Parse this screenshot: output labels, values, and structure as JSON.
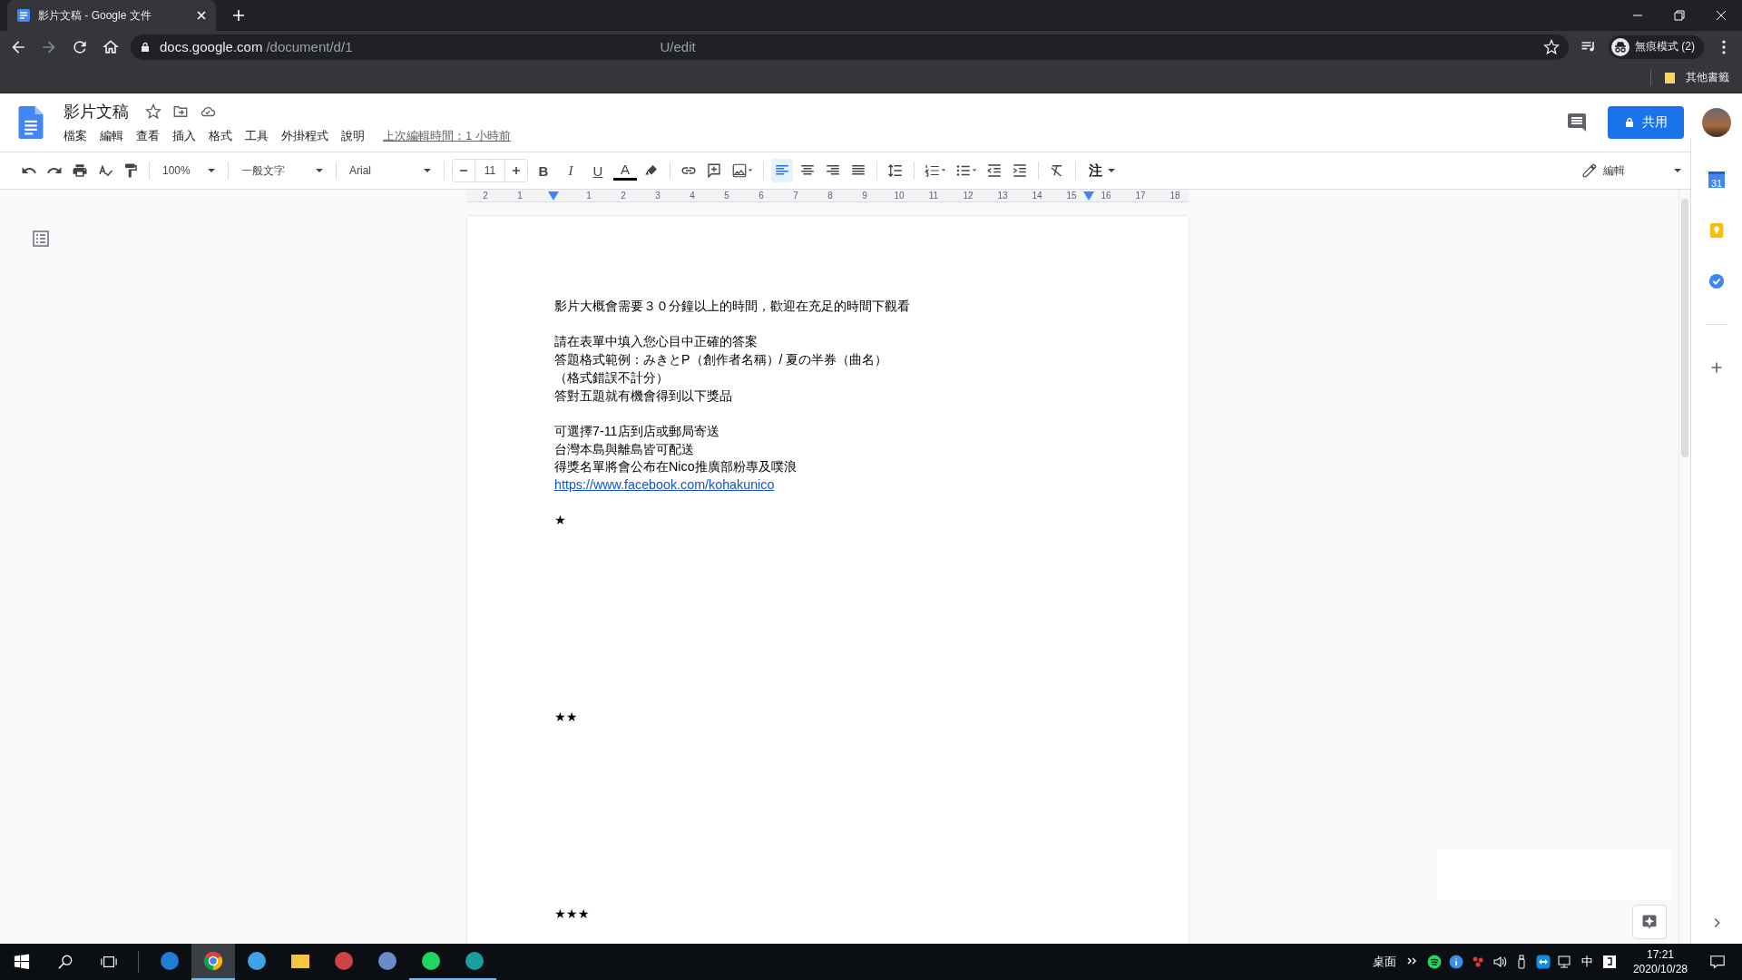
{
  "browser": {
    "tab_title": "影片文稿 - Google 文件",
    "url_host": "docs.google.com",
    "url_path": "/document/d/1",
    "url_tail": "U/edit",
    "profile": "無痕模式 (2)",
    "bookmark": "其他書籤"
  },
  "docs": {
    "title": "影片文稿",
    "menus": [
      "檔案",
      "編輯",
      "查看",
      "插入",
      "格式",
      "工具",
      "外掛程式",
      "說明"
    ],
    "last_edit": "上次編輯時間：1 小時前",
    "share": "共用"
  },
  "toolbar": {
    "zoom": "100%",
    "style": "一般文字",
    "font": "Arial",
    "font_size": "11",
    "format": [
      "B",
      "I",
      "U"
    ],
    "text_color": "A",
    "align": [
      {
        "selected": true
      },
      {
        "selected": false
      },
      {
        "selected": false
      },
      {
        "selected": false
      }
    ],
    "input_tool": "注",
    "mode": "編輯"
  },
  "ruler": [
    "2",
    "1",
    "1",
    "2",
    "3",
    "4",
    "5",
    "6",
    "7",
    "8",
    "9",
    "10",
    "11",
    "12",
    "13",
    "14",
    "15",
    "16",
    "17",
    "18"
  ],
  "document": [
    {
      "kind": "text",
      "lines": [
        {
          "kind": "text",
          "text": "影片大概會需要３０分鐘以上的時間，歡迎在充足的時間下觀看"
        }
      ]
    },
    {
      "kind": "text",
      "lines": [
        {
          "kind": "text",
          "text": "請在表單中填入您心目中正確的答案"
        },
        {
          "kind": "text",
          "text": "答題格式範例：みきとP（創作者名稱）/ 夏の半券（曲名）"
        },
        {
          "kind": "text",
          "text": "（格式錯誤不計分）"
        },
        {
          "kind": "text",
          "text": "答對五題就有機會得到以下獎品"
        }
      ]
    },
    {
      "kind": "text",
      "lines": [
        {
          "kind": "text",
          "text": "可選擇7-11店到店或郵局寄送"
        },
        {
          "kind": "text",
          "text": "台灣本島與離島皆可配送"
        },
        {
          "kind": "text",
          "text": "得獎名單將會公布在Nico推廣部粉專及噗浪"
        },
        {
          "kind": "link",
          "text": "https://www.facebook.com/kohakunico"
        }
      ]
    },
    {
      "kind": "stars",
      "lines": [
        {
          "kind": "text",
          "text": "★"
        }
      ]
    },
    {
      "kind": "stars",
      "lines": [
        {
          "kind": "text",
          "text": "★★"
        }
      ]
    },
    {
      "kind": "stars",
      "lines": [
        {
          "kind": "text",
          "text": "★★★"
        }
      ]
    }
  ],
  "side_panel": {
    "calendar_day": "31"
  },
  "taskbar": {
    "apps": [
      {
        "selected": false,
        "running": false
      },
      {
        "selected": true,
        "running": true
      },
      {
        "selected": false,
        "running": false
      },
      {
        "selected": false,
        "running": false
      },
      {
        "selected": false,
        "running": false
      },
      {
        "selected": false,
        "running": false
      },
      {
        "selected": false,
        "running": true
      },
      {
        "selected": false,
        "running": true
      }
    ],
    "desktop": "桌面",
    "ime": "中",
    "time": "17:21",
    "date": "2020/10/28"
  }
}
